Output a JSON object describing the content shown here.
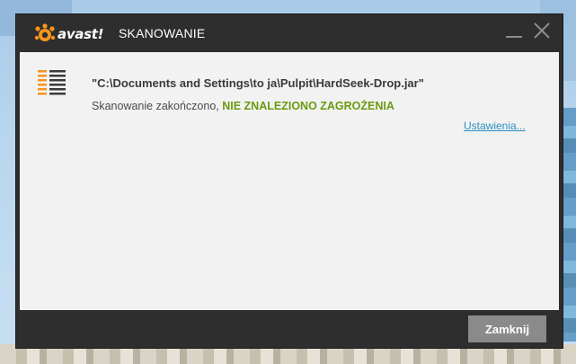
{
  "window": {
    "brand": "avast!",
    "title": "SKANOWANIE"
  },
  "scan": {
    "file_path": "\"C:\\Documents and Settings\\to ja\\Pulpit\\HardSeek-Drop.jar\"",
    "status_prefix": "Skanowanie zakończono, ",
    "status_result": "NIE ZNALEZIONO ZAGROŻENIA",
    "settings_link": "Ustawienia..."
  },
  "footer": {
    "close_label": "Zamknij"
  },
  "colors": {
    "brand_orange": "#f7941d",
    "result_green": "#6a9a10",
    "link_blue": "#2a8fc4",
    "dialog_dark": "#2e2e2e",
    "content_bg": "#f2f2f2"
  },
  "icons": {
    "brand": "avast-logo-icon",
    "scan": "scan-list-icon",
    "minimize": "minimize-icon",
    "close": "close-icon"
  }
}
